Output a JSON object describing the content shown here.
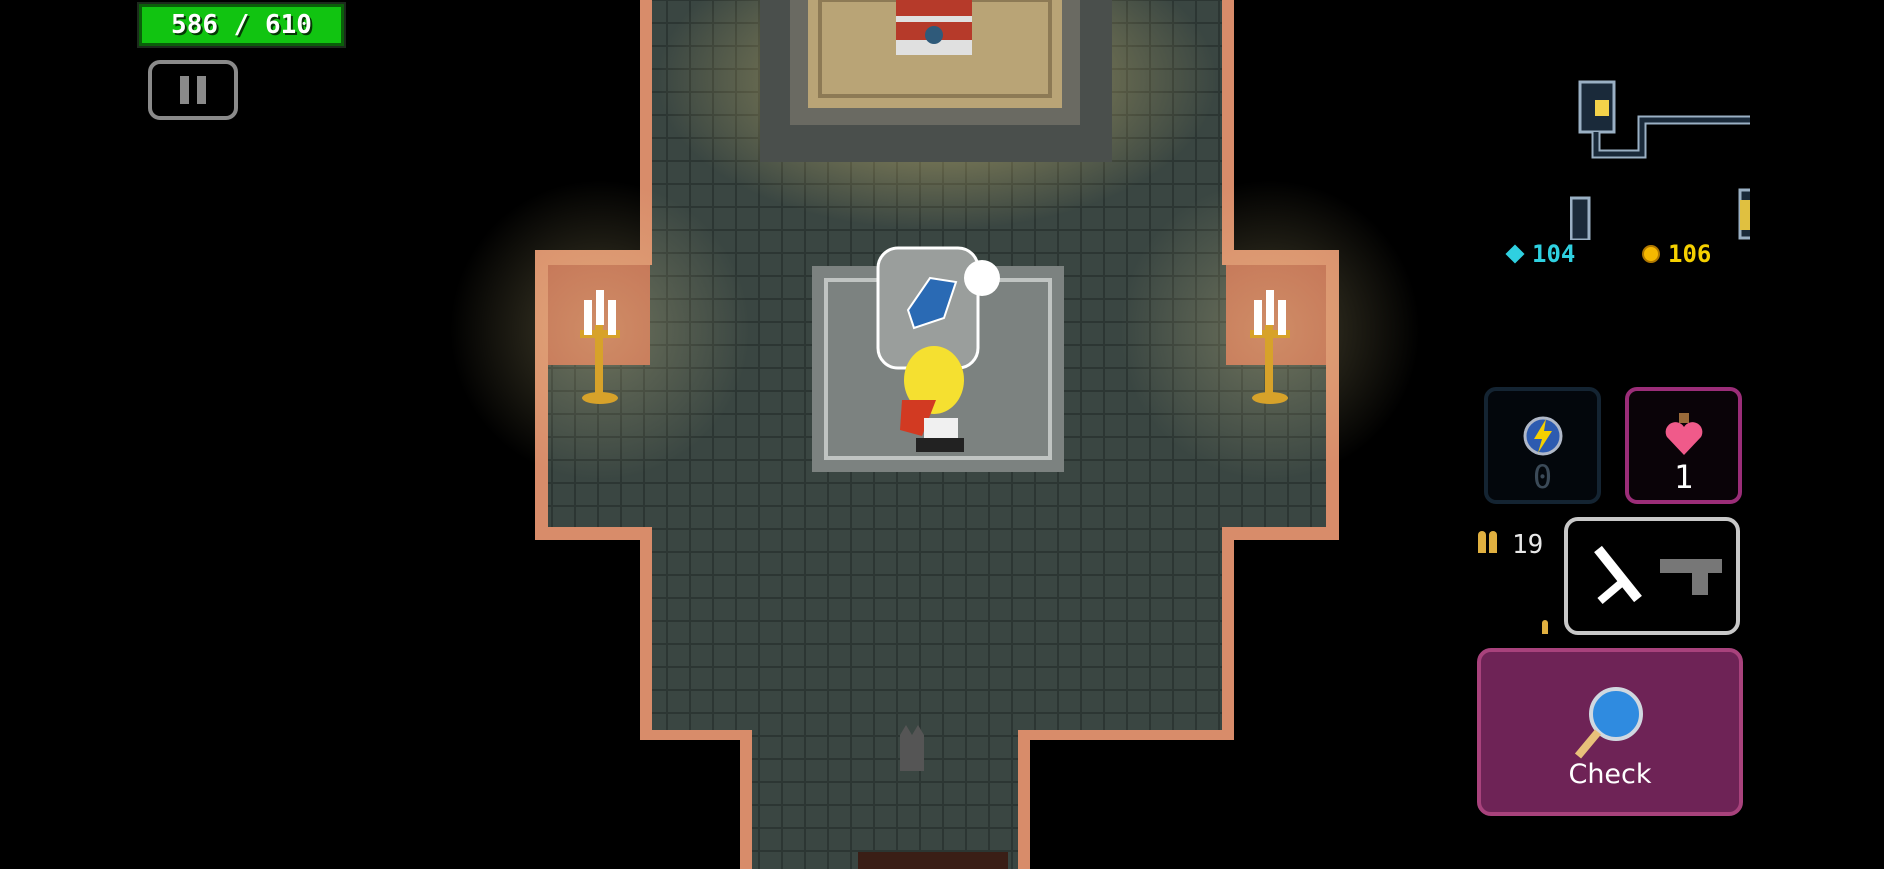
{
  "hud": {
    "hp_text": "586 / 610",
    "hp_current": 586,
    "hp_max": 610,
    "hp_color": "#11c411"
  },
  "currency": {
    "gems": "104",
    "gold": "106"
  },
  "slots": {
    "skill_count": "0",
    "potion_count": "1",
    "ammo_count": "19"
  },
  "actions": {
    "check_label": "Check"
  },
  "icons": {
    "pause": "pause-icon",
    "skill": "lightning-orb-icon",
    "potion": "heart-potion-icon",
    "sword": "sword-icon",
    "gun": "pistol-icon",
    "magnifier": "magnifying-glass-icon"
  },
  "colors": {
    "background": "#000000",
    "floor": "#34403c",
    "wall_trim": "#d88c6a",
    "check_button": "#6e2356"
  }
}
